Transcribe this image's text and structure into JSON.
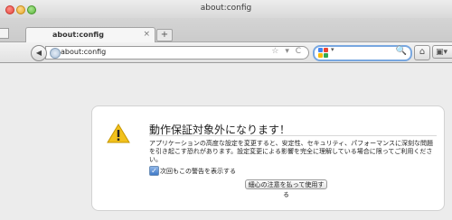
{
  "window": {
    "title": "about:config"
  },
  "tabs": [
    {
      "label": "about:config",
      "close": "×"
    }
  ],
  "newtab": {
    "label": "+"
  },
  "navbar": {
    "back_glyph": "◀",
    "url": "about:config",
    "url_icons": "☆ ▾ C",
    "search_placeholder": "",
    "search_arrow": "▾",
    "search_glyph": "🔍",
    "home_glyph": "⌂",
    "menu_glyph": "▣▾"
  },
  "warning": {
    "title": "動作保証対象外になります！",
    "text": "アプリケーションの高度な設定を変更すると、安定性、セキュリティ、パフォーマンスに深刻な問題を引き起こす恐れがあります。設定変更による影響を完全に理解している場合に限ってご利用ください。",
    "checkbox_checked": true,
    "checkbox_glyph": "✓",
    "checkbox_label": "次回もこの警告を表示する",
    "button_label": "細心の注意を払って使用する"
  },
  "colors": {
    "warning_fill": "#f2c11c",
    "google_blue": "#4285f4",
    "google_red": "#ea4335",
    "google_yellow": "#fbbc05",
    "google_green": "#34a853"
  },
  "icons": [
    "back-arrow-icon",
    "globe-icon",
    "star-icon",
    "reload-icon",
    "google-icon",
    "search-icon",
    "home-icon",
    "menu-icon",
    "warning-icon",
    "close-icon",
    "plus-icon",
    "check-icon"
  ]
}
